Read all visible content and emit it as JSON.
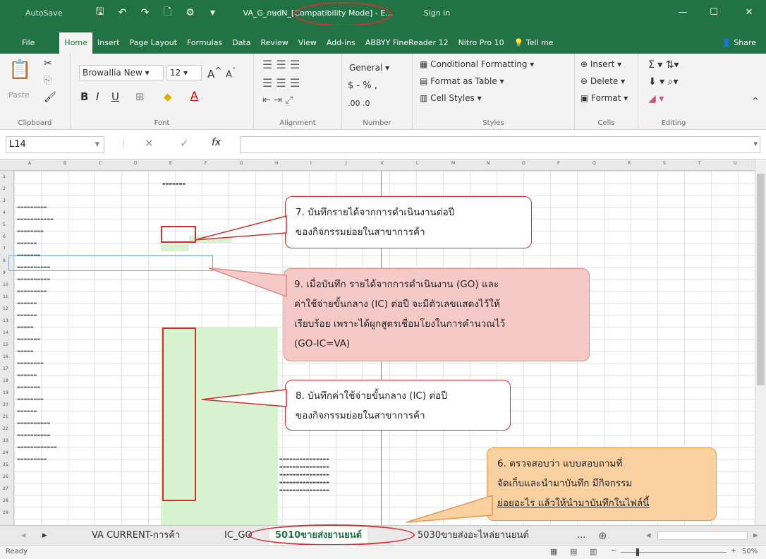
{
  "titlebar": {
    "autosave": "AutoSave",
    "doc_title": "VA_G_กษdN_[Compatibility Mode] - E...",
    "signin": "Sign in"
  },
  "tabs": [
    "File",
    "Home",
    "Insert",
    "Page Layout",
    "Formulas",
    "Data",
    "Review",
    "View",
    "Add-ins",
    "ABBYY FineReader 12",
    "Nitro Pro 10",
    "Tell me"
  ],
  "share": "Share",
  "ribbon": {
    "clipboard": {
      "paste": "Paste",
      "label": "Clipboard"
    },
    "font": {
      "name": "Browallia New",
      "size": "12",
      "label": "Font"
    },
    "alignment": {
      "label": "Alignment"
    },
    "number": {
      "format": "General",
      "label": "Number"
    },
    "styles": {
      "cond": "Conditional Formatting",
      "table": "Format as Table",
      "cell": "Cell Styles",
      "label": "Styles"
    },
    "cells": {
      "insert": "Insert",
      "delete": "Delete",
      "format": "Format",
      "label": "Cells"
    },
    "editing": {
      "label": "Editing"
    }
  },
  "formula": {
    "namebox": "L14",
    "fx": "fx"
  },
  "columns": [
    "A",
    "B",
    "C",
    "D",
    "E",
    "F",
    "G",
    "H",
    "I",
    "J",
    "K",
    "L",
    "M",
    "N",
    "O",
    "P",
    "Q",
    "R",
    "S",
    "T",
    "U"
  ],
  "callouts": {
    "c7": [
      "7. บันทึกรายได้จากการดำเนินงานต่อปี",
      "ของกิจกรรมย่อยในสาขาการค้า"
    ],
    "c9": [
      "9. เมื่อบันทึก รายได้จากการดำเนินงาน (GO) และ",
      "ค่าใช้จ่ายขั้นกลาง (IC) ต่อปี จะมีตัวเลขแสดงไว้ให้",
      "เรียบร้อย เพราะได้ผูกสูตรเชื่อมโยงในการคำนวณไว้",
      "(GO-IC=VA)"
    ],
    "c8": [
      "8. บันทึกค่าใช้จ่ายขั้นกลาง (IC) ต่อปี",
      "ของกิจกรรมย่อยในสาขาการค้า"
    ],
    "c6": [
      "6. ตรวจสอบว่า แบบสอบถามที่",
      "จัดเก็บและนำมาบันทึก มีกิจกรรม",
      "ย่อยอะไร แล้วให้นำมาบันทึกในไฟล์นี้"
    ]
  },
  "sheet_tabs": [
    "VA CURRENT-การค้า",
    "IC_GO",
    "5010ขายส่งยานยนต์",
    "5030ขายส่งอะไหล่ยานยนต์",
    "..."
  ],
  "status": {
    "ready": "Ready",
    "zoom": "50%"
  }
}
